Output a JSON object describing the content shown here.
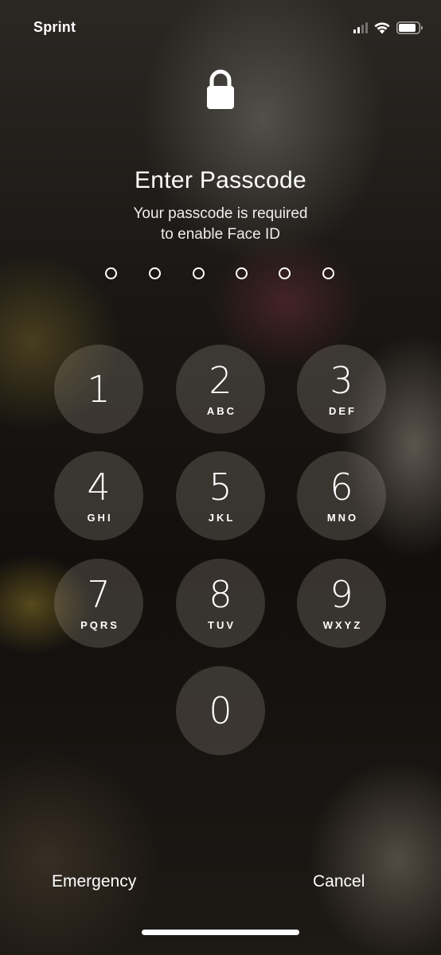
{
  "status_bar": {
    "carrier": "Sprint",
    "signal_icon": "cellular-signal-icon",
    "wifi_icon": "wifi-icon",
    "battery_icon": "battery-icon"
  },
  "lock": {
    "icon": "lock-icon"
  },
  "title": "Enter Passcode",
  "subtitle_lines": [
    "Your passcode is required",
    "to enable Face ID"
  ],
  "passcode": {
    "length": 6,
    "entered": 0
  },
  "keypad": [
    {
      "digit": "1",
      "letters": ""
    },
    {
      "digit": "2",
      "letters": "ABC"
    },
    {
      "digit": "3",
      "letters": "DEF"
    },
    {
      "digit": "4",
      "letters": "GHI"
    },
    {
      "digit": "5",
      "letters": "JKL"
    },
    {
      "digit": "6",
      "letters": "MNO"
    },
    {
      "digit": "7",
      "letters": "PQRS"
    },
    {
      "digit": "8",
      "letters": "TUV"
    },
    {
      "digit": "9",
      "letters": "WXYZ"
    },
    {
      "digit": "0",
      "letters": ""
    }
  ],
  "bottom": {
    "emergency_label": "Emergency",
    "cancel_label": "Cancel"
  }
}
